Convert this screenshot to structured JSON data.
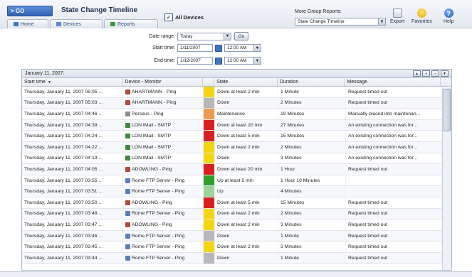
{
  "header": {
    "go_label": "> GO",
    "title": "State Change Timeline",
    "tabs": [
      {
        "label": "Home"
      },
      {
        "label": "Devices"
      },
      {
        "label": "Reports"
      }
    ],
    "all_devices_label": "All Devices",
    "more_reports_label": "More Group Reports:",
    "more_reports_value": "State Change Timeline",
    "tools": [
      {
        "label": "Export",
        "icon": "export-icon"
      },
      {
        "label": "Favorites",
        "icon": "favorites-icon"
      },
      {
        "label": "Help",
        "icon": "help-icon"
      }
    ]
  },
  "filters": {
    "date_range_label": "Date range:",
    "date_range_value": "Today",
    "go_button": "Go",
    "start_time_label": "Start time:",
    "start_date": "1/11/2007",
    "start_clock": "12:00 AM",
    "end_time_label": "End time:",
    "end_date": "1/12/2007",
    "end_clock": "12:00 AM"
  },
  "grid": {
    "date_header": "January 11, 2007:",
    "columns": {
      "start": "Start time",
      "device": "Device - Monitor",
      "state": "State",
      "duration": "Duration",
      "message": "Message"
    },
    "colors": {
      "yellow": "#f3d512",
      "red": "#d92020",
      "orange": "#f09a52",
      "green": "#2ea02e",
      "lightgreen": "#9fd39a",
      "gray": "#b8b8b8"
    },
    "rows": [
      {
        "start": "Thursday, January 11, 2007 05:05 ...",
        "device": "AHARTMANN - Ping",
        "state": "Down at least 2 min",
        "duration": "1 Minute",
        "message": "Request timed out",
        "color": "yellow"
      },
      {
        "start": "Thursday, January 11, 2007 05:03 ...",
        "device": "AHARTMANN - Ping",
        "state": "Down",
        "duration": "2 Minutes",
        "message": "Request timed out",
        "color": "gray"
      },
      {
        "start": "Thursday, January 11, 2007 04:46 ...",
        "device": "Perseus - Ping",
        "state": "Maintenance",
        "duration": "19 Minutes",
        "message": "Manually placed into maintenan...",
        "color": "orange"
      },
      {
        "start": "Thursday, January 11, 2007 04:39 ...",
        "device": "LON IMail - SMTP",
        "state": "Down at least 20 min",
        "duration": "27 Minutes",
        "message": "An existing connection was for...",
        "color": "red"
      },
      {
        "start": "Thursday, January 11, 2007 04:24 ...",
        "device": "LON IMail - SMTP",
        "state": "Down at least 5 min",
        "duration": "15 Minutes",
        "message": "An existing connection was for...",
        "color": "red"
      },
      {
        "start": "Thursday, January 11, 2007 04:22 ...",
        "device": "LON IMail - SMTP",
        "state": "Down at least 2 min",
        "duration": "2 Minutes",
        "message": "An existing connection was for...",
        "color": "yellow"
      },
      {
        "start": "Thursday, January 11, 2007 04:19 ...",
        "device": "LON IMail - SMTP",
        "state": "Down",
        "duration": "3 Minutes",
        "message": "An existing connection was for...",
        "color": "yellow"
      },
      {
        "start": "Thursday, January 11, 2007 04:05 ...",
        "device": "ADOWLING - Ping",
        "state": "Down at least 20 min",
        "duration": "1 Hour",
        "message": "Request timed out",
        "color": "red"
      },
      {
        "start": "Thursday, January 11, 2007 03:55 ...",
        "device": "Rome FTP Server - Ping",
        "state": "Up at least 5 min",
        "duration": "1 Hour 10 Minutes",
        "message": "",
        "color": "green"
      },
      {
        "start": "Thursday, January 11, 2007 03:51 ...",
        "device": "Rome FTP Server - Ping",
        "state": "Up",
        "duration": "4 Minutes",
        "message": "",
        "color": "lightgreen"
      },
      {
        "start": "Thursday, January 11, 2007 03:50 ...",
        "device": "ADOWLING - Ping",
        "state": "Down at least 5 min",
        "duration": "15 Minutes",
        "message": "Request timed out",
        "color": "red"
      },
      {
        "start": "Thursday, January 11, 2007 03:48 ...",
        "device": "Rome FTP Server - Ping",
        "state": "Down at least 2 min",
        "duration": "2 Minutes",
        "message": "Request timed out",
        "color": "yellow"
      },
      {
        "start": "Thursday, January 11, 2007 03:47 ...",
        "device": "ADOWLING - Ping",
        "state": "Down at least 2 min",
        "duration": "3 Minutes",
        "message": "Request timed out",
        "color": "yellow"
      },
      {
        "start": "Thursday, January 11, 2007 03:46 ...",
        "device": "Rome FTP Server - Ping",
        "state": "Down",
        "duration": "1 Minute",
        "message": "Request timed out",
        "color": "gray"
      },
      {
        "start": "Thursday, January 11, 2007 03:45 ...",
        "device": "Rome FTP Server - Ping",
        "state": "Down at least 2 min",
        "duration": "3 Minutes",
        "message": "Request timed out",
        "color": "yellow"
      },
      {
        "start": "Thursday, January 11, 2007 03:44 ...",
        "device": "Rome FTP Server - Ping",
        "state": "Down",
        "duration": "1 Minute",
        "message": "Request timed out",
        "color": "gray"
      }
    ]
  }
}
